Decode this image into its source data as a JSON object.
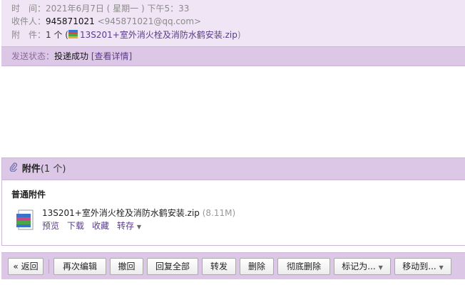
{
  "header": {
    "time_label": "时　间：",
    "time_value": "2021年6月7日 ( 星期一 ) 下午5：33",
    "recipient_label": "收件人：",
    "recipient_name": "945871021",
    "recipient_email": "<945871021@qq.com>",
    "attachment_label": "附　件：",
    "attachment_count": "1 个 (",
    "attachment_file": "13S201+室外消火栓及消防水鹤安装.zip",
    "attachment_close": ")"
  },
  "status": {
    "label": "发送状态：",
    "value": "投递成功",
    "details_link": "[查看详情]"
  },
  "attachments": {
    "title": "附件",
    "count": "(1 个)",
    "section_label": "普通附件",
    "file_name": "13S201+室外消火栓及消防水鹤安装.zip",
    "file_size": "(8.11M)",
    "actions": {
      "preview": "预览",
      "download": "下载",
      "favorite": "收藏",
      "forward": "转存"
    },
    "icons": {
      "clip": "paperclip-icon",
      "file": "zip-file-icon",
      "caret": "caret-down-icon"
    }
  },
  "toolbar": {
    "back": "« 返回",
    "edit_again": "再次编辑",
    "recall": "撤回",
    "reply_all": "回复全部",
    "forward": "转发",
    "delete": "删除",
    "delete_permanent": "彻底删除",
    "mark_as": "标记为...",
    "move_to": "移动到..."
  },
  "colors": {
    "header_bg": "#f0e5f4",
    "bar_bg": "#dcc8e6",
    "link": "#5a3b8c"
  }
}
